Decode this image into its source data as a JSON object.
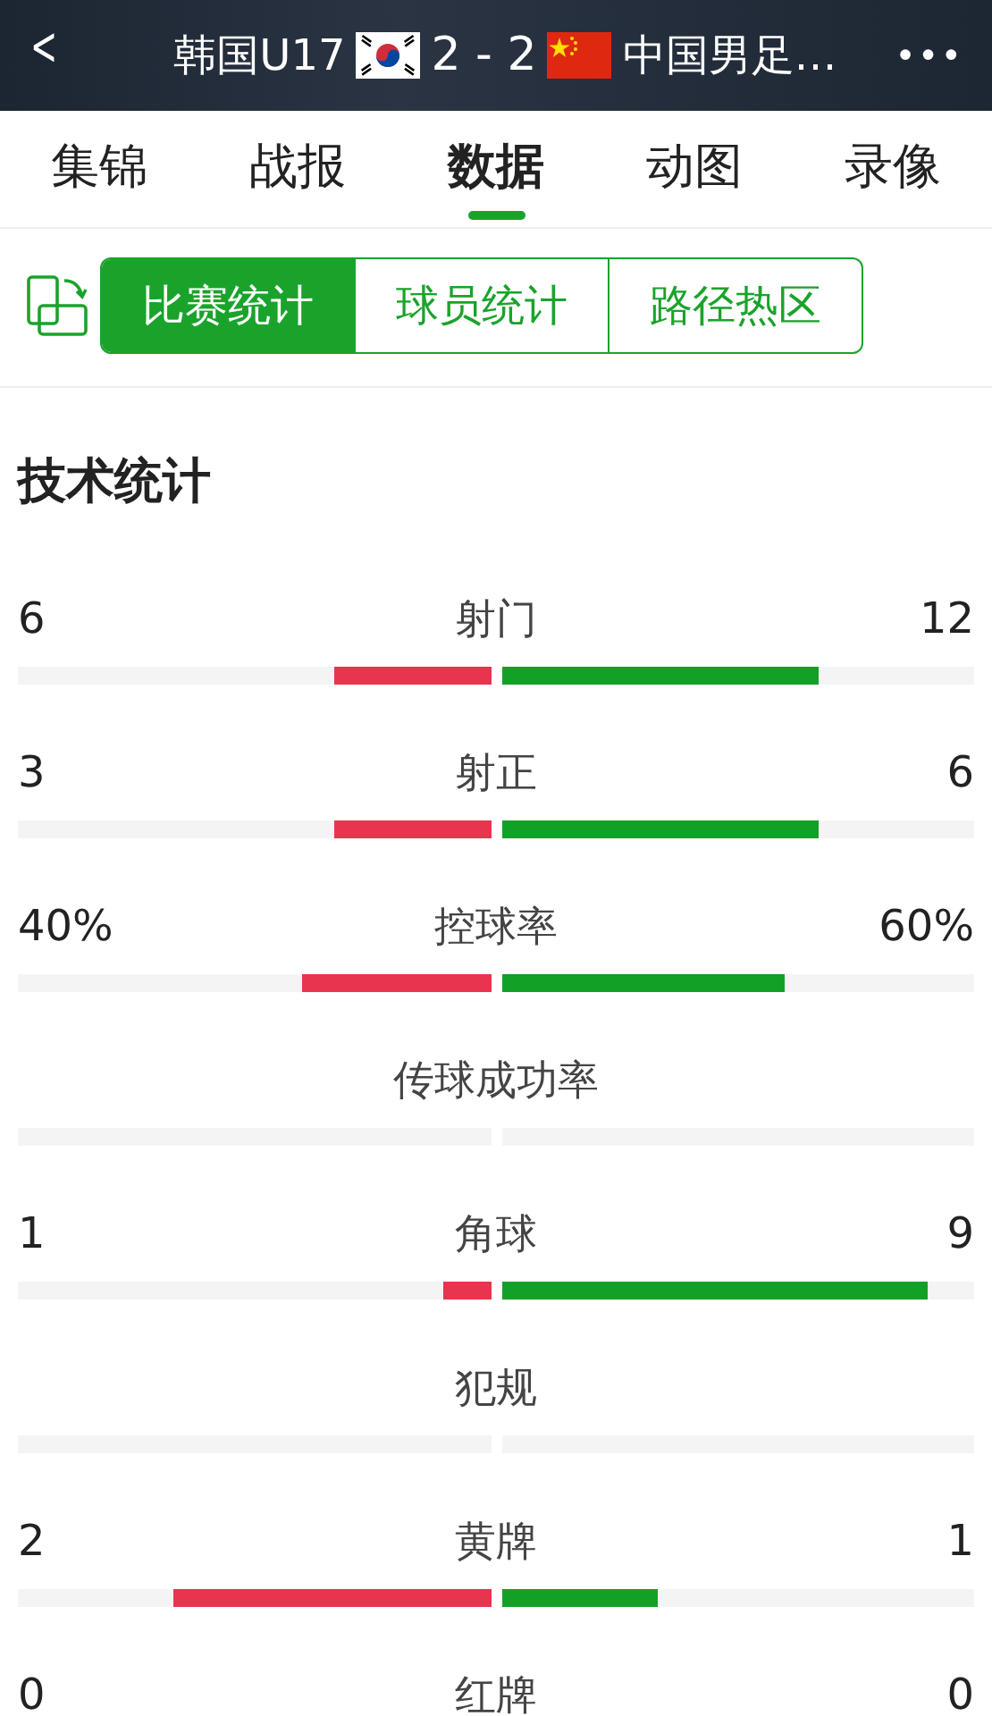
{
  "header": {
    "back": "<",
    "home_team": "韩国U17",
    "score": "2 - 2",
    "away_team": "中国男足…",
    "more": "•••"
  },
  "tabs": [
    {
      "label": "集锦",
      "selected": false
    },
    {
      "label": "战报",
      "selected": false
    },
    {
      "label": "数据",
      "selected": true
    },
    {
      "label": "动图",
      "selected": false
    },
    {
      "label": "录像",
      "selected": false
    }
  ],
  "segments": [
    {
      "label": "比赛统计",
      "selected": true
    },
    {
      "label": "球员统计",
      "selected": false
    },
    {
      "label": "路径热区",
      "selected": false
    }
  ],
  "section_title": "技术统计",
  "stats": [
    {
      "label": "射门",
      "home": {
        "value": "6",
        "level": 0.33
      },
      "away": {
        "value": "12",
        "level": 0.67
      }
    },
    {
      "label": "射正",
      "home": {
        "value": "3",
        "level": 0.33
      },
      "away": {
        "value": "6",
        "level": 0.67
      }
    },
    {
      "label": "控球率",
      "home": {
        "value": "40%",
        "level": 0.4
      },
      "away": {
        "value": "60%",
        "level": 0.6
      }
    },
    {
      "label": "传球成功率"
    },
    {
      "label": "角球",
      "home": {
        "value": "1",
        "level": 0.1
      },
      "away": {
        "value": "9",
        "level": 0.9
      }
    },
    {
      "label": "犯规"
    },
    {
      "label": "黄牌",
      "home": {
        "value": "2",
        "level": 0.67
      },
      "away": {
        "value": "1",
        "level": 0.33
      }
    },
    {
      "label": "红牌",
      "home": {
        "value": "0"
      },
      "away": {
        "value": "0"
      }
    }
  ]
}
